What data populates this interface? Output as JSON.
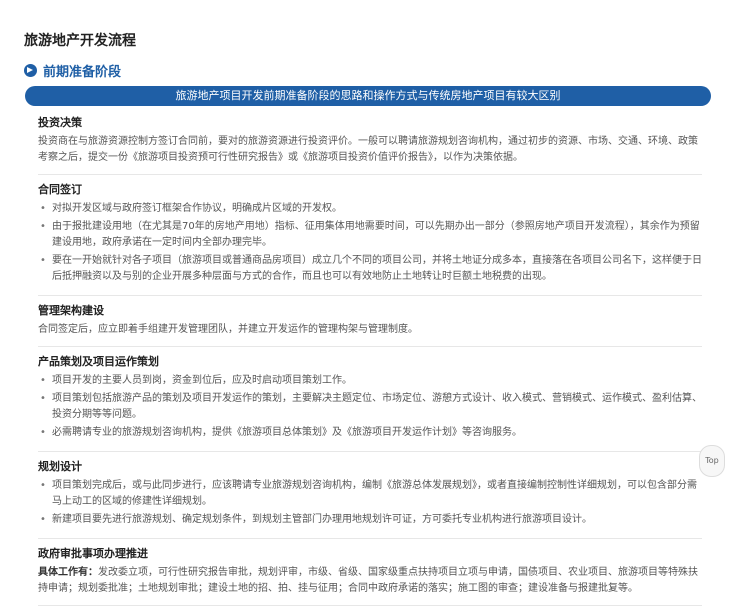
{
  "page": {
    "title": "旅游地产开发流程",
    "section": "前期准备阶段",
    "banner": "旅游地产项目开发前期准备阶段的思路和操作方式与传统房地产项目有较大区别"
  },
  "blocks": [
    {
      "title": "投资决策",
      "paragraph": "投资商在与旅游资源控制方签订合同前，要对的旅游资源进行投资评价。一般可以聘请旅游规划咨询机构，通过初步的资源、市场、交通、环境、政策考察之后，提交一份《旅游项目投资预可行性研究报告》或《旅游项目投资价值评价报告》，以作为决策依据。"
    },
    {
      "title": "合同签订",
      "bullets": [
        "对拟开发区域与政府签订框架合作协议，明确成片区域的开发权。",
        "由于报批建设用地（在尤其是70年的房地产用地）指标、征用集体用地需要时间，可以先期办出一部分（参照房地产项目开发流程），其余作为预留建设用地，政府承诺在一定时间内全部办理完毕。",
        "要在一开始就针对各子项目（旅游项目或普通商品房项目）成立几个不同的项目公司，并将土地证分成多本，直接落在各项目公司名下，这样便于日后抵押融资以及与别的企业开展多种层面与方式的合作，而且也可以有效地防止土地转让时巨额土地税费的出现。"
      ]
    },
    {
      "title": "管理架构建设",
      "paragraph": "合同签定后，应立即着手组建开发管理团队，并建立开发运作的管理构架与管理制度。"
    },
    {
      "title": "产品策划及项目运作策划",
      "bullets": [
        "项目开发的主要人员到岗，资金到位后，应及时启动项目策划工作。",
        "项目策划包括旅游产品的策划及项目开发运作的策划，主要解决主题定位、市场定位、游憩方式设计、收入模式、营销模式、运作模式、盈利估算、投资分期等等问题。",
        "必需聘请专业的旅游规划咨询机构，提供《旅游项目总体策划》及《旅游项目开发运作计划》等咨询服务。"
      ]
    },
    {
      "title": "规划设计",
      "bullets": [
        "项目策划完成后，或与此同步进行，应该聘请专业旅游规划咨询机构，编制《旅游总体发展规划》，或者直接编制控制性详细规划，可以包含部分需马上动工的区域的修建性详细规划。",
        "新建项目要先进行旅游规划、确定规划条件，到规划主管部门办理用地规划许可证，方可委托专业机构进行旅游项目设计。"
      ]
    },
    {
      "title": "政府审批事项办理推进",
      "lead": "具体工作有：",
      "paragraph": "发改委立项，可行性研究报告审批，规划评审，市级、省级、国家级重点扶持项目立项与申请，国债项目、农业项目、旅游项目等特殊扶持申请；规划委批准；土地规划审批；建设土地的招、拍、挂与征用；合同中政府承诺的落实；施工图的审查；建设准备与报建批复等。"
    }
  ],
  "ui": {
    "top_label": "Top"
  }
}
